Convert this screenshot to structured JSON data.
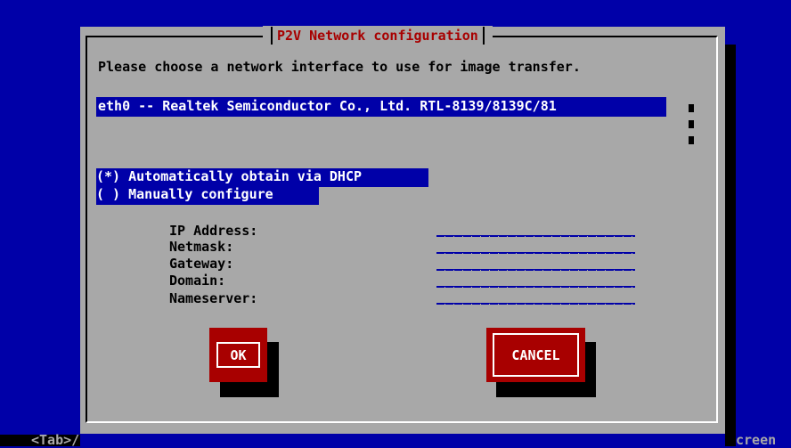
{
  "dialog": {
    "title": "P2V Network configuration",
    "prompt": "Please choose a network interface to use for image transfer.",
    "interfaces": [
      "eth0 -- Realtek Semiconductor Co., Ltd. RTL-8139/8139C/81"
    ],
    "dhcp_option": "(*) Automatically obtain via DHCP",
    "manual_option": "( ) Manually configure",
    "fields": {
      "ip_address": {
        "label": "IP Address:",
        "value": ""
      },
      "netmask": {
        "label": "Netmask:",
        "value": ""
      },
      "gateway": {
        "label": "Gateway:",
        "value": ""
      },
      "domain": {
        "label": "Domain:",
        "value": ""
      },
      "nameserver": {
        "label": "Nameserver:",
        "value": ""
      }
    },
    "ok_label": "OK",
    "cancel_label": "CANCEL"
  },
  "statusbar": {
    "left": "<Tab>/",
    "right": "creen"
  },
  "colors": {
    "background": "#0000a8",
    "dialog": "#a8a8a8",
    "accent": "#a80000",
    "highlight": "#0000a8"
  }
}
